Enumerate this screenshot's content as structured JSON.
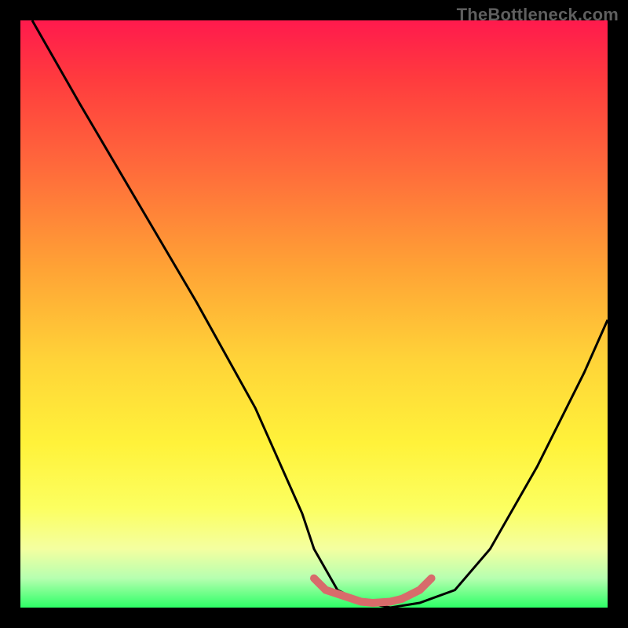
{
  "watermark": {
    "text": "TheBottleneck.com"
  },
  "chart_data": {
    "type": "line",
    "title": "",
    "xlabel": "",
    "ylabel": "",
    "xlim": [
      0,
      100
    ],
    "ylim": [
      0,
      100
    ],
    "grid": false,
    "legend": false,
    "annotations": [],
    "gradient": {
      "orientation": "vertical",
      "stops": [
        {
          "pos": 0,
          "color": "#ff1a4d"
        },
        {
          "pos": 10,
          "color": "#ff3b3e"
        },
        {
          "pos": 25,
          "color": "#ff6a3b"
        },
        {
          "pos": 42,
          "color": "#ffa235"
        },
        {
          "pos": 58,
          "color": "#ffd438"
        },
        {
          "pos": 72,
          "color": "#fff23a"
        },
        {
          "pos": 83,
          "color": "#fcff60"
        },
        {
          "pos": 90,
          "color": "#f4ffa0"
        },
        {
          "pos": 95,
          "color": "#b6ffb0"
        },
        {
          "pos": 100,
          "color": "#2dff66"
        }
      ]
    },
    "series": [
      {
        "name": "bottleneck-curve",
        "style": "line",
        "color": "#000000",
        "x": [
          2,
          10,
          20,
          30,
          40,
          48,
          50,
          54,
          58,
          63,
          68,
          74,
          80,
          88,
          96,
          100
        ],
        "y": [
          100,
          86,
          69,
          52,
          34,
          16,
          10,
          3,
          1,
          0,
          0.8,
          3,
          10,
          24,
          40,
          49
        ]
      },
      {
        "name": "optimal-band",
        "style": "line",
        "color": "#d86b6b",
        "x": [
          50,
          52,
          55,
          58,
          60,
          63,
          65,
          68,
          70
        ],
        "y": [
          5,
          3,
          2,
          1,
          0.8,
          1,
          1.5,
          3,
          5
        ]
      }
    ]
  }
}
